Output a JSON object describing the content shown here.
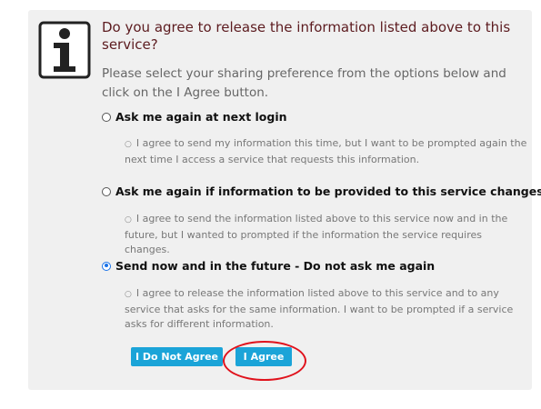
{
  "title": "Do you agree to release the information listed above to this service?",
  "intro": "Please select your sharing preference from the options below and click on the I Agree button.",
  "options": [
    {
      "label": "Ask me again at next login",
      "description": "I agree to send my information this time, but I want to be prompted again the next time I access a service that requests this information.",
      "selected": false
    },
    {
      "label": "Ask me again if information to be provided to this service changes",
      "description": "I agree to send the information listed above to this service now and in the future, but I wanted to prompted if the information the service requires changes.",
      "selected": false
    },
    {
      "label": "Send now and in the future - Do not ask me again",
      "description": "I agree to release the information listed above to this service and to any service that asks for the same information. I want to be prompted if a service asks for different information.",
      "selected": true
    }
  ],
  "buttons": {
    "disagree": "I Do Not Agree",
    "agree": "I Agree"
  },
  "colors": {
    "title": "#5c1b1f",
    "button": "#1ba4d8",
    "highlight": "#e0121c",
    "panel": "#f0f0f0"
  },
  "icons": {
    "info": "info-icon"
  }
}
